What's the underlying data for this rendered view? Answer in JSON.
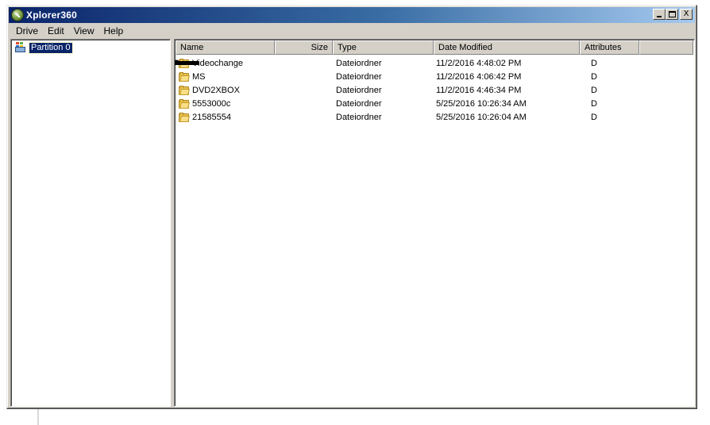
{
  "window": {
    "title": "Xplorer360",
    "minimize_icon": "minimize-icon",
    "maximize_icon": "maximize-icon",
    "close_label": "X"
  },
  "menu": {
    "items": [
      {
        "label": "Drive"
      },
      {
        "label": "Edit"
      },
      {
        "label": "View"
      },
      {
        "label": "Help"
      }
    ]
  },
  "tree": {
    "items": [
      {
        "label": "Partition 0",
        "icon": "drive-icon",
        "selected": true
      }
    ]
  },
  "list": {
    "columns": [
      {
        "label": "Name"
      },
      {
        "label": "Size"
      },
      {
        "label": "Type"
      },
      {
        "label": "Date Modified"
      },
      {
        "label": "Attributes"
      }
    ],
    "rows": [
      {
        "name": "Videochange",
        "size": "",
        "type": "Dateiordner",
        "date": "11/2/2016 4:48:02 PM",
        "attr": "D",
        "redacted": true
      },
      {
        "name": "MS",
        "size": "",
        "type": "Dateiordner",
        "date": "11/2/2016 4:06:42 PM",
        "attr": "D",
        "redacted": true
      },
      {
        "name": "DVD2XBOX",
        "size": "",
        "type": "Dateiordner",
        "date": "11/2/2016 4:46:34 PM",
        "attr": "D",
        "redacted": true
      },
      {
        "name": "5553000c",
        "size": "",
        "type": "Dateiordner",
        "date": "5/25/2016 10:26:34 AM",
        "attr": "D",
        "redacted": false
      },
      {
        "name": "21585554",
        "size": "",
        "type": "Dateiordner",
        "date": "5/25/2016 10:26:04 AM",
        "attr": "D",
        "redacted": false
      }
    ]
  },
  "colors": {
    "title_gradient_start": "#0a246a",
    "title_gradient_end": "#a6caf0",
    "selection": "#0a246a",
    "window_face": "#d4d0c8"
  }
}
